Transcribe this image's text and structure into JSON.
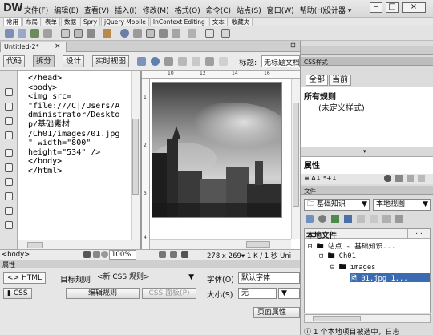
{
  "app": {
    "logo": "DW",
    "designer_label": "设计器",
    "designer_arrow": "▾"
  },
  "menu": [
    "文件(F)",
    "编辑(E)",
    "查看(V)",
    "插入(I)",
    "修改(M)",
    "格式(O)",
    "命令(C)",
    "站点(S)",
    "窗口(W)",
    "帮助(H)"
  ],
  "window_buttons": {
    "minimize": "–",
    "maximize": "□",
    "close": "×"
  },
  "insert_tabs": [
    "常用",
    "布局",
    "表单",
    "数据",
    "Spry",
    "jQuery Mobile",
    "InContext Editing",
    "文本",
    "收藏夹"
  ],
  "document": {
    "tab_name": "Untitled-2*",
    "tab_close": "×",
    "path_glyph": "⊡",
    "view_buttons": [
      "代码",
      "拆分",
      "设计",
      "实时视图"
    ],
    "title_label": "标题:",
    "title_value": "无标题文档"
  },
  "code_lines": [
    "</head>",
    "",
    "<body>",
    "<img src=",
    "\"file:///C|/Users/A",
    "dministrator/Deskto",
    "p/基础素材",
    "/Ch01/images/01.jpg",
    "\" width=\"800\"",
    "height=\"534\" />",
    "</body>",
    "</html>"
  ],
  "ruler_ticks": [
    "10",
    "12",
    "14",
    "16"
  ],
  "ruler_left_ticks": [
    "1",
    "2",
    "3",
    "4"
  ],
  "status": {
    "tag": "<body>",
    "zoom": "100%",
    "size": "278 x 269▾ 1 K / 1 秒 Uni"
  },
  "properties": {
    "title": "属性",
    "html_button": "<> HTML",
    "css_button": "CSS",
    "target_rule_label": "目标规则",
    "target_rule_value": "<新 CSS 规则>",
    "font_label": "字体(O)",
    "font_value": "默认字体",
    "edit_rule_button": "编辑规则",
    "css_panel_button": "CSS 面板(P)",
    "size_label": "大小(S)",
    "size_value": "无",
    "page_props_button": "页面属性"
  },
  "css_panel": {
    "title": "CSS样式",
    "tab_all": "全部",
    "tab_current": "当前",
    "rules_title": "所有规则",
    "rules_item": "(未定义样式)",
    "props_title": "属性",
    "props_icons": "≡ A↓ *+↓"
  },
  "files_panel": {
    "title": "文件",
    "site_select": "基础知识",
    "view_select": "本地视图",
    "local_files_header": "本地文件",
    "tree": [
      {
        "text": "⊟ 🖿 站点 - 基础知识..."
      },
      {
        "text": "⊟ 🖿 Ch01"
      },
      {
        "text": "⊟ 🖿 images"
      },
      {
        "text": "🖻 01.jpg   1..."
      }
    ],
    "status": "1 个本地项目被选中，日志"
  },
  "colors": {
    "selection": "#3b6bb0",
    "panel_bg": "#dcdcdc"
  }
}
